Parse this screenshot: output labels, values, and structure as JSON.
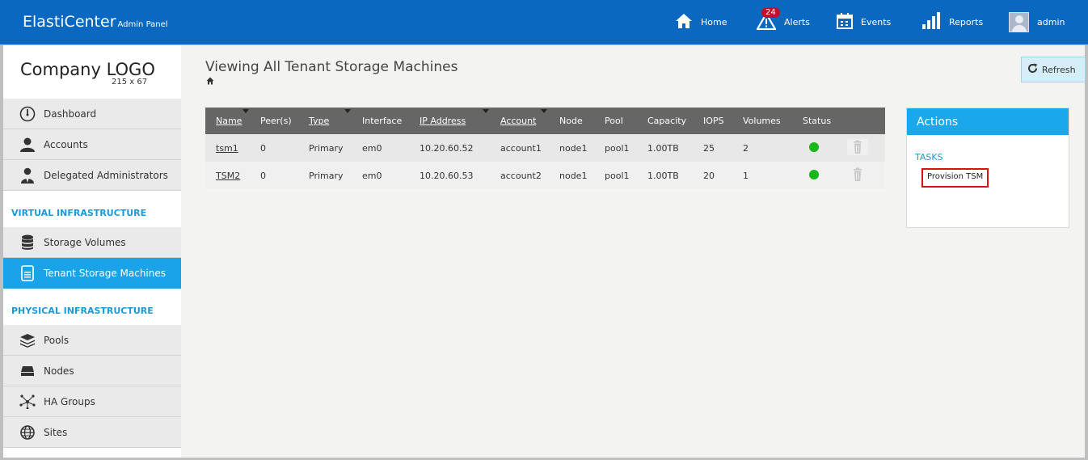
{
  "header": {
    "brand": "ElastiCenter",
    "brand_sub": "Admin Panel",
    "nav": {
      "home": "Home",
      "alerts": "Alerts",
      "alerts_count": "24",
      "events": "Events",
      "reports": "Reports",
      "user": "admin"
    }
  },
  "sidebar": {
    "logo": {
      "title": "Company LOGO",
      "dims": "215 x 67"
    },
    "items_top": [
      {
        "label": "Dashboard",
        "icon": "dashboard-gauge-icon"
      },
      {
        "label": "Accounts",
        "icon": "user-icon"
      },
      {
        "label": "Delegated Administrators",
        "icon": "admin-user-icon"
      }
    ],
    "section_virtual": "VIRTUAL INFRASTRUCTURE",
    "items_virtual": [
      {
        "label": "Storage Volumes",
        "icon": "database-icon"
      },
      {
        "label": "Tenant Storage Machines",
        "icon": "server-icon",
        "active": true
      }
    ],
    "section_physical": "PHYSICAL INFRASTRUCTURE",
    "items_physical": [
      {
        "label": "Pools",
        "icon": "layers-icon"
      },
      {
        "label": "Nodes",
        "icon": "disk-icon"
      },
      {
        "label": "HA Groups",
        "icon": "network-icon"
      },
      {
        "label": "Sites",
        "icon": "globe-icon"
      }
    ]
  },
  "main": {
    "title": "Viewing All Tenant Storage Machines",
    "refresh_label": "Refresh",
    "table": {
      "columns": [
        "Name",
        "Peer(s)",
        "Type",
        "Interface",
        "IP Address",
        "Account",
        "Node",
        "Pool",
        "Capacity",
        "IOPS",
        "Volumes",
        "Status"
      ],
      "rows": [
        [
          "tsm1",
          "0",
          "Primary",
          "em0",
          "10.20.60.52",
          "account1",
          "node1",
          "pool1",
          "1.00TB",
          "25",
          "2"
        ],
        [
          "TSM2",
          "0",
          "Primary",
          "em0",
          "10.20.60.53",
          "account2",
          "node1",
          "pool1",
          "1.00TB",
          "20",
          "1"
        ]
      ],
      "status_color": "#18b818"
    },
    "actions": {
      "title": "Actions",
      "tasks_label": "TASKS",
      "provision_label": "Provision TSM"
    }
  },
  "colors": {
    "topbar": "#0a68c0",
    "accent": "#1aa3e8",
    "highlight_border": "#d81111"
  }
}
